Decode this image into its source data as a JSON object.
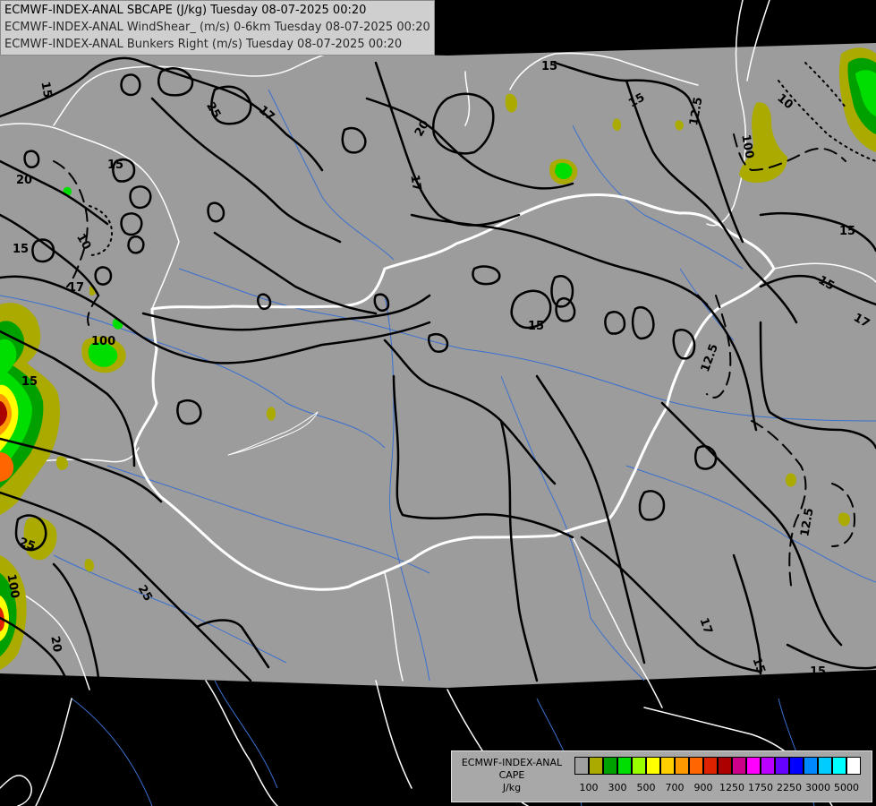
{
  "header": {
    "line1": "ECMWF-INDEX-ANAL SBCAPE (J/kg) Tuesday 08-07-2025 00:20",
    "line2": "ECMWF-INDEX-ANAL WindShear_ (m/s) 0-6km Tuesday 08-07-2025 00:20",
    "line3": "ECMWF-INDEX-ANAL Bunkers Right (m/s) Tuesday 08-07-2025 00:20"
  },
  "legend": {
    "title_line1": "ECMWF-INDEX-ANAL",
    "title_line2": "CAPE",
    "title_line3": "J/kg",
    "colors": [
      "#a0a0a0",
      "#aaaa00",
      "#00a000",
      "#00dd00",
      "#99ff00",
      "#ffff00",
      "#ffd000",
      "#ff9900",
      "#ff6600",
      "#dd2200",
      "#aa0000",
      "#cc0088",
      "#ff00ff",
      "#bb00ff",
      "#6600ff",
      "#0000ff",
      "#0088ff",
      "#00ccff",
      "#00ffff",
      "#ffffff"
    ],
    "ticks": [
      "100",
      "300",
      "500",
      "700",
      "900",
      "1250",
      "1750",
      "2250",
      "3000",
      "5000"
    ]
  },
  "contour_labels": [
    "15",
    "17",
    "20",
    "25",
    "15",
    "17",
    "20",
    "15",
    "15",
    "15",
    "12.5",
    "10",
    "100",
    "15",
    "17",
    "12.5",
    "15",
    "12.5",
    "17",
    "15",
    "15",
    "25",
    "20",
    "100",
    "25",
    "100",
    "10",
    "15",
    "17",
    "15"
  ],
  "colors": {
    "domain": "#9c9c9c",
    "outside": "#000000",
    "border": "#ffffff",
    "river": "#3a6fd0",
    "contour": "#000000"
  }
}
